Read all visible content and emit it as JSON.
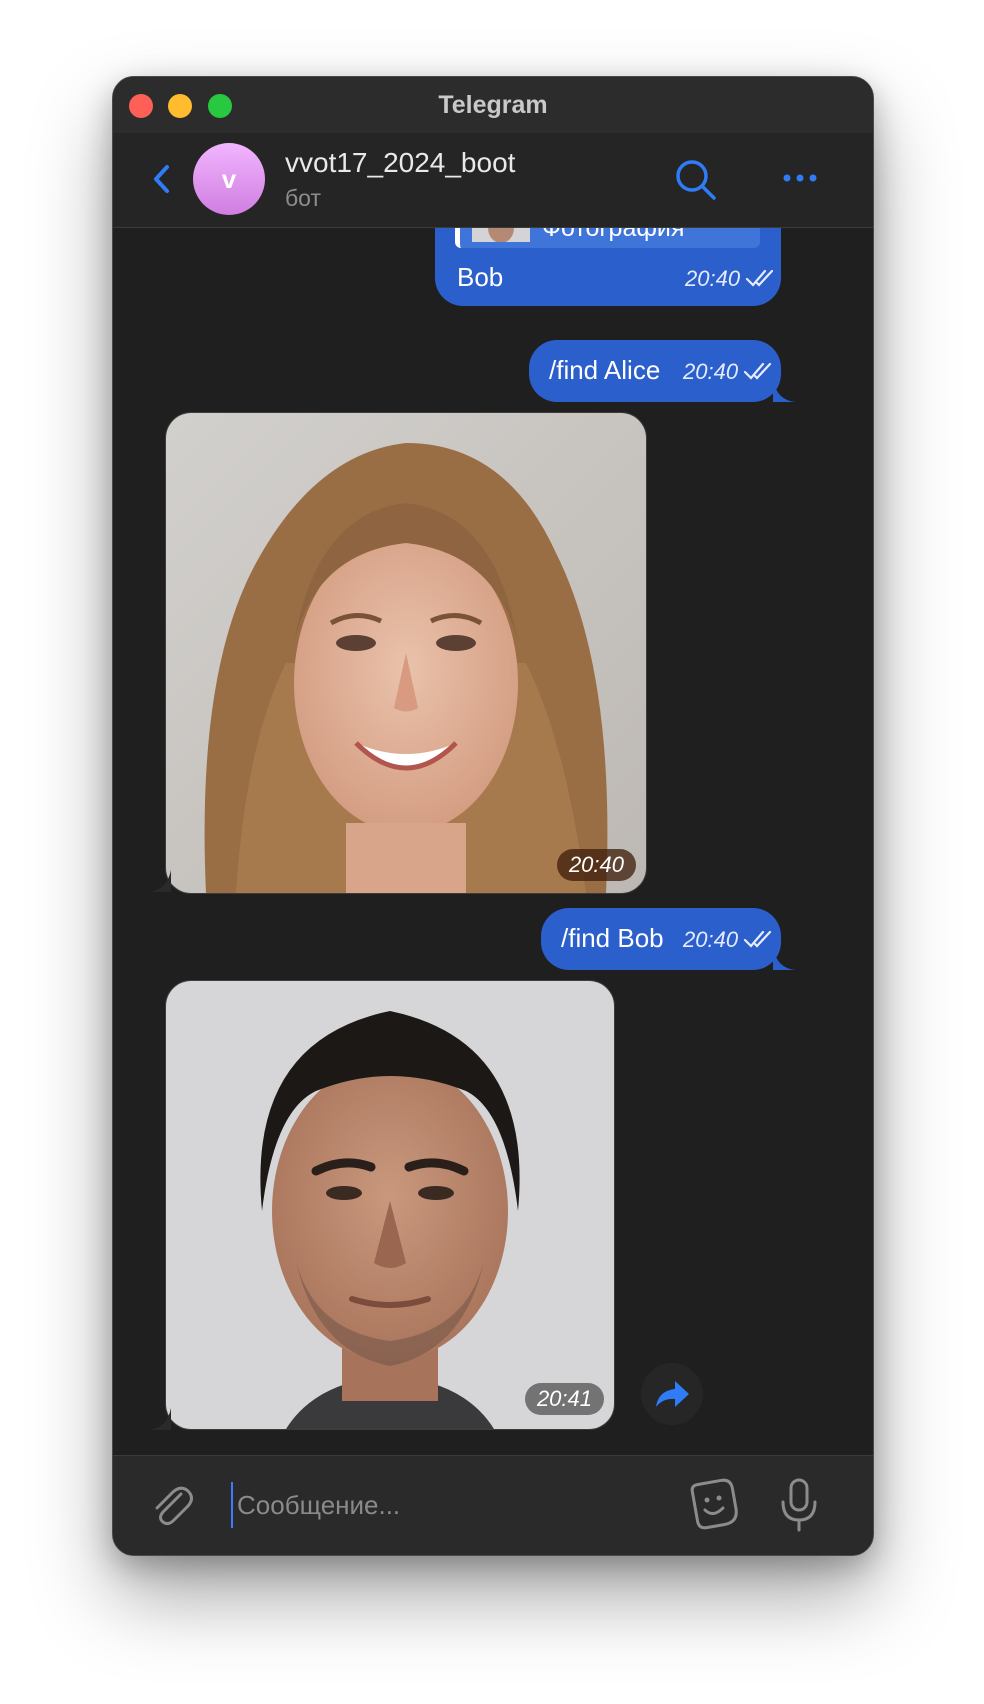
{
  "window": {
    "title": "Telegram"
  },
  "header": {
    "avatar_letter": "v",
    "chat_name": "vvot17_2024_boot",
    "chat_status": "бот",
    "avatar_color": "#e39af2",
    "accent_color": "#2f7cf6"
  },
  "messages": [
    {
      "direction": "outgoing",
      "reply_label": "Фотография",
      "text": "Bob",
      "time": "20:40",
      "status": "read"
    },
    {
      "direction": "outgoing",
      "text": "/find Alice",
      "time": "20:40",
      "status": "read"
    },
    {
      "direction": "incoming",
      "type": "photo",
      "time": "20:40"
    },
    {
      "direction": "outgoing",
      "text": "/find Bob",
      "time": "20:40",
      "status": "read"
    },
    {
      "direction": "incoming",
      "type": "photo",
      "time": "20:41"
    }
  ],
  "composer": {
    "placeholder": "Сообщение..."
  },
  "icons": {
    "back": "chevron-left-icon",
    "search": "search-icon",
    "more": "more-dots-icon",
    "forward": "forward-arrow-icon",
    "attach": "paperclip-icon",
    "sticker": "sticker-icon",
    "mic": "microphone-icon"
  }
}
